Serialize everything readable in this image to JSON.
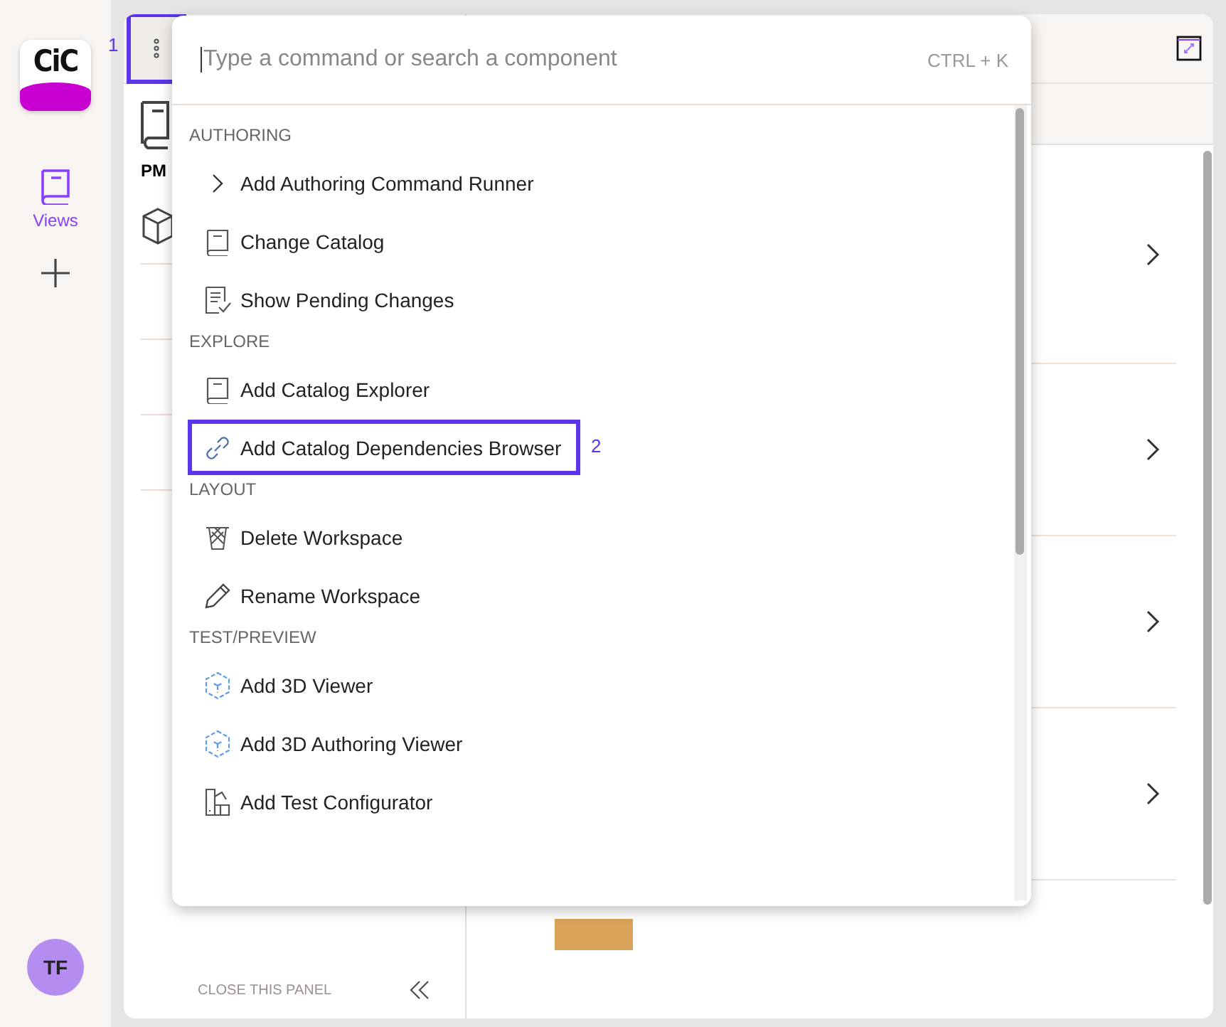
{
  "rail": {
    "logo": "CiC",
    "nav": [
      {
        "label": "Views",
        "selected": true
      }
    ],
    "avatar": "TF"
  },
  "side_panel": {
    "menu_button": {
      "highlighted": true,
      "annotation": "1"
    },
    "heading": "PM",
    "close_label": "CLOSE THIS PANEL"
  },
  "palette": {
    "placeholder": "Type a command or search a component",
    "shortcut": "CTRL + K",
    "groups": [
      {
        "title": "AUTHORING",
        "items": [
          {
            "label": "Add Authoring Command Runner",
            "kind": "runner",
            "highlighted": false
          },
          {
            "label": "Change Catalog",
            "kind": "catalog",
            "highlighted": false
          },
          {
            "label": "Show Pending Changes",
            "kind": "changes",
            "highlighted": false
          }
        ]
      },
      {
        "title": "EXPLORE",
        "items": [
          {
            "label": "Add Catalog Explorer",
            "kind": "catalog",
            "highlighted": false
          },
          {
            "label": "Add Catalog Dependencies Browser",
            "kind": "dependencies",
            "highlighted": true,
            "annotation": "2"
          }
        ]
      },
      {
        "title": "LAYOUT",
        "items": [
          {
            "label": "Delete Workspace",
            "kind": "delete",
            "highlighted": false
          },
          {
            "label": "Rename Workspace",
            "kind": "rename",
            "highlighted": false
          }
        ]
      },
      {
        "title": "TEST/PREVIEW",
        "items": [
          {
            "label": "Add 3D Viewer",
            "kind": "viewer",
            "highlighted": false
          },
          {
            "label": "Add 3D Authoring Viewer",
            "kind": "viewer",
            "highlighted": false
          },
          {
            "label": "Add Test Configurator",
            "kind": "configurator",
            "highlighted": false
          }
        ]
      }
    ]
  }
}
